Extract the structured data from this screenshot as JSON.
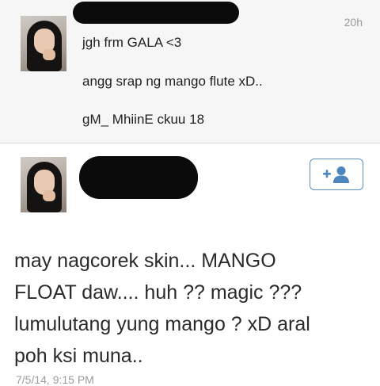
{
  "tweet1": {
    "timestamp": "20h",
    "lines": [
      "jgh frm GALA <3",
      "angg srap ng mango flute xD..",
      "gM_ MhiinE ckuu 18"
    ]
  },
  "tweet2": {
    "follow_icon": "add-user-icon",
    "text_lines": [
      "may nagcorek skin... MANGO",
      "FLOAT daw.... huh ?? magic ???",
      "lumulutang yung mango ? xD aral",
      "poh ksi muna.."
    ],
    "date": "7/5/14, 9:15 PM"
  },
  "colors": {
    "accent": "#4d86bf",
    "muted_text": "#9a9a9a",
    "redaction": "#0b0b0b"
  }
}
